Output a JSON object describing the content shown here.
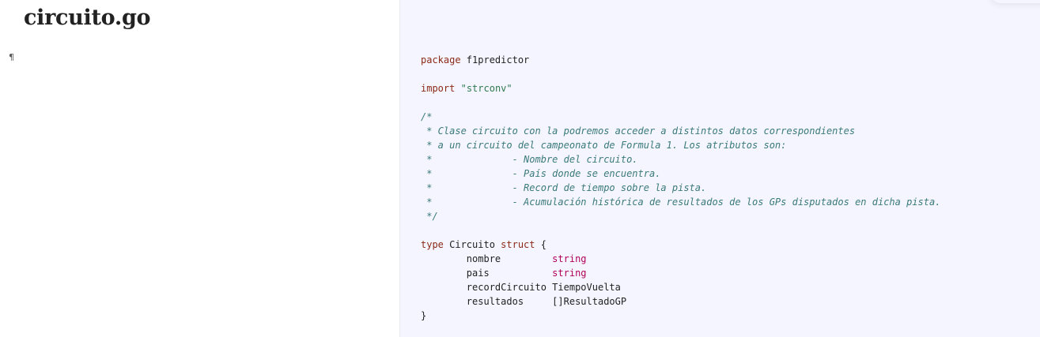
{
  "document": {
    "title": "circuito.go",
    "paragraph_mark": "¶"
  },
  "code": {
    "lines": [
      [
        {
          "t": "kw",
          "v": "package"
        },
        {
          "t": "plain",
          "v": " f1predictor"
        }
      ],
      [],
      [
        {
          "t": "kw",
          "v": "import"
        },
        {
          "t": "plain",
          "v": " "
        },
        {
          "t": "str",
          "v": "\"strconv\""
        }
      ],
      [],
      [
        {
          "t": "cm",
          "v": "/*"
        }
      ],
      [
        {
          "t": "cm",
          "v": " * Clase circuito con la podremos acceder a distintos datos correspondientes"
        }
      ],
      [
        {
          "t": "cm",
          "v": " * a un circuito del campeonato de Formula 1. Los atributos son:"
        }
      ],
      [
        {
          "t": "cm",
          "v": " *\t\t- Nombre del circuito."
        }
      ],
      [
        {
          "t": "cm",
          "v": " *\t\t- País donde se encuentra."
        }
      ],
      [
        {
          "t": "cm",
          "v": " *\t\t- Record de tiempo sobre la pista."
        }
      ],
      [
        {
          "t": "cm",
          "v": " *\t\t- Acumulación histórica de resultados de los GPs disputados en dicha pista."
        }
      ],
      [
        {
          "t": "cm",
          "v": " */"
        }
      ],
      [],
      [
        {
          "t": "kw",
          "v": "type"
        },
        {
          "t": "plain",
          "v": " Circuito "
        },
        {
          "t": "kw",
          "v": "struct"
        },
        {
          "t": "plain",
          "v": " {"
        }
      ],
      [
        {
          "t": "plain",
          "v": "\tnombre         "
        },
        {
          "t": "ty",
          "v": "string"
        }
      ],
      [
        {
          "t": "plain",
          "v": "\tpais           "
        },
        {
          "t": "ty",
          "v": "string"
        }
      ],
      [
        {
          "t": "plain",
          "v": "\trecordCircuito TiempoVuelta"
        }
      ],
      [
        {
          "t": "plain",
          "v": "\tresultados     []ResultadoGP"
        }
      ],
      [
        {
          "t": "plain",
          "v": "}"
        }
      ]
    ]
  },
  "colors": {
    "code_background": "#f5f5ff",
    "keyword": "#8b2a16",
    "string": "#2f7a4f",
    "comment": "#3a7a7a",
    "builtin_type": "#b0005a"
  }
}
